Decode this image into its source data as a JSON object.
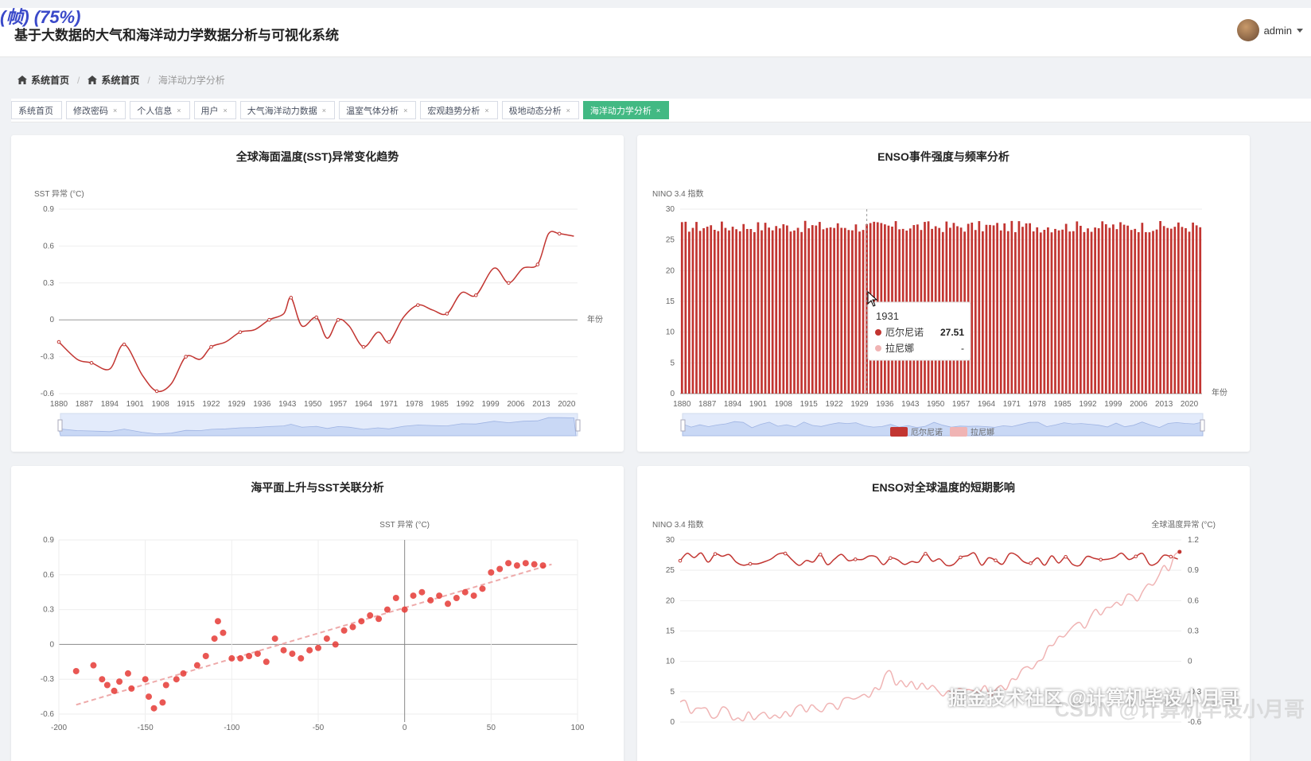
{
  "overlay_label": "(帧) (75%)",
  "header": {
    "title": "基于大数据的大气和海洋动力学数据分析与可视化系统",
    "username": "admin"
  },
  "breadcrumb": [
    "系统首页",
    "系统首页",
    "海洋动力学分析"
  ],
  "tags": [
    {
      "label": "系统首页",
      "closable": false,
      "active": false
    },
    {
      "label": "修改密码",
      "closable": true,
      "active": false
    },
    {
      "label": "个人信息",
      "closable": true,
      "active": false
    },
    {
      "label": "用户",
      "closable": true,
      "active": false
    },
    {
      "label": "大气海洋动力数据",
      "closable": true,
      "active": false
    },
    {
      "label": "温室气体分析",
      "closable": true,
      "active": false
    },
    {
      "label": "宏观趋势分析",
      "closable": true,
      "active": false
    },
    {
      "label": "极地动态分析",
      "closable": true,
      "active": false
    },
    {
      "label": "海洋动力学分析",
      "closable": true,
      "active": true
    }
  ],
  "close_glyph": "×",
  "colors": {
    "accent": "#42b983",
    "el_nino": "#c23531",
    "la_nina": "#f0b4b4",
    "scatter": "#e53935"
  },
  "watermark": {
    "text1": "掘金技术社区 @计算机毕设小月哥",
    "text2": "CSDN @计算机毕设小月哥"
  },
  "chart_data": [
    {
      "type": "line",
      "title": "全球海面温度(SST)异常变化趋势",
      "ylabel": "SST 异常 (°C)",
      "xlabel": "年份",
      "ylim": [
        -0.6,
        0.9
      ],
      "yticks": [
        "-0.6",
        "-0.3",
        "0",
        "0.3",
        "0.6",
        "0.9"
      ],
      "xticks": [
        "1880",
        "1887",
        "1894",
        "1901",
        "1908",
        "1915",
        "1922",
        "1929",
        "1936",
        "1943",
        "1950",
        "1957",
        "1964",
        "1971",
        "1978",
        "1985",
        "1992",
        "1999",
        "2006",
        "2013",
        "2020"
      ],
      "x": [
        1880,
        1885,
        1889,
        1894,
        1898,
        1903,
        1907,
        1911,
        1915,
        1919,
        1922,
        1926,
        1930,
        1934,
        1938,
        1942,
        1944,
        1947,
        1951,
        1954,
        1957,
        1960,
        1964,
        1968,
        1971,
        1975,
        1979,
        1983,
        1987,
        1991,
        1995,
        2000,
        2004,
        2008,
        2012,
        2015,
        2018,
        2022
      ],
      "y": [
        -0.18,
        -0.32,
        -0.35,
        -0.4,
        -0.2,
        -0.45,
        -0.58,
        -0.52,
        -0.3,
        -0.32,
        -0.22,
        -0.18,
        -0.1,
        -0.08,
        0.0,
        0.05,
        0.18,
        -0.05,
        0.02,
        -0.15,
        0.0,
        -0.05,
        -0.22,
        -0.1,
        -0.18,
        0.02,
        0.12,
        0.08,
        0.05,
        0.22,
        0.2,
        0.42,
        0.3,
        0.42,
        0.45,
        0.7,
        0.7,
        0.68
      ],
      "grid": true,
      "data_zoom": true
    },
    {
      "type": "bar",
      "title": "ENSO事件强度与频率分析",
      "ylabel": "NINO 3.4 指数",
      "xlabel": "年份",
      "ylim": [
        0,
        30
      ],
      "yticks": [
        "0",
        "5",
        "10",
        "15",
        "20",
        "25",
        "30"
      ],
      "xticks": [
        "1880",
        "1887",
        "1894",
        "1901",
        "1908",
        "1915",
        "1922",
        "1929",
        "1936",
        "1943",
        "1950",
        "1957",
        "1964",
        "1971",
        "1978",
        "1985",
        "1992",
        "1999",
        "2006",
        "2013",
        "2020"
      ],
      "year_range": [
        1880,
        2023
      ],
      "series": [
        {
          "name": "厄尔尼诺"
        },
        {
          "name": "拉尼娜"
        }
      ],
      "typical_range": [
        26.2,
        28.1
      ],
      "tooltip": {
        "year": "1931",
        "rows": [
          {
            "label": "厄尔尼诺",
            "value": "27.51"
          },
          {
            "label": "拉尼娜",
            "value": "-"
          }
        ]
      },
      "legend": "bottom-center",
      "data_zoom": true
    },
    {
      "type": "scatter",
      "title": "海平面上升与SST关联分析",
      "ylabel": "SST 异常 (°C)",
      "xlim": [
        -200,
        100
      ],
      "ylim": [
        -0.6,
        0.9
      ],
      "xticks": [
        "-200",
        "-150",
        "-100",
        "-50",
        "0",
        "50",
        "100"
      ],
      "yticks": [
        "-0.6",
        "-0.3",
        "0",
        "0.3",
        "0.6",
        "0.9"
      ],
      "points": [
        [
          -190,
          -0.23
        ],
        [
          -180,
          -0.18
        ],
        [
          -175,
          -0.3
        ],
        [
          -172,
          -0.35
        ],
        [
          -168,
          -0.4
        ],
        [
          -165,
          -0.32
        ],
        [
          -160,
          -0.25
        ],
        [
          -158,
          -0.38
        ],
        [
          -150,
          -0.3
        ],
        [
          -148,
          -0.45
        ],
        [
          -145,
          -0.55
        ],
        [
          -140,
          -0.5
        ],
        [
          -138,
          -0.35
        ],
        [
          -132,
          -0.3
        ],
        [
          -128,
          -0.25
        ],
        [
          -120,
          -0.18
        ],
        [
          -115,
          -0.1
        ],
        [
          -110,
          0.05
        ],
        [
          -108,
          0.2
        ],
        [
          -105,
          0.1
        ],
        [
          -100,
          -0.12
        ],
        [
          -95,
          -0.12
        ],
        [
          -90,
          -0.1
        ],
        [
          -85,
          -0.08
        ],
        [
          -80,
          -0.15
        ],
        [
          -75,
          0.05
        ],
        [
          -70,
          -0.05
        ],
        [
          -65,
          -0.08
        ],
        [
          -60,
          -0.12
        ],
        [
          -55,
          -0.05
        ],
        [
          -50,
          -0.03
        ],
        [
          -45,
          0.05
        ],
        [
          -40,
          0.0
        ],
        [
          -35,
          0.12
        ],
        [
          -30,
          0.15
        ],
        [
          -25,
          0.2
        ],
        [
          -20,
          0.25
        ],
        [
          -15,
          0.22
        ],
        [
          -10,
          0.3
        ],
        [
          -5,
          0.4
        ],
        [
          0,
          0.3
        ],
        [
          5,
          0.42
        ],
        [
          10,
          0.45
        ],
        [
          15,
          0.38
        ],
        [
          20,
          0.42
        ],
        [
          25,
          0.35
        ],
        [
          30,
          0.4
        ],
        [
          35,
          0.45
        ],
        [
          40,
          0.42
        ],
        [
          45,
          0.48
        ],
        [
          50,
          0.62
        ],
        [
          55,
          0.65
        ],
        [
          60,
          0.7
        ],
        [
          65,
          0.68
        ],
        [
          70,
          0.7
        ],
        [
          75,
          0.69
        ],
        [
          80,
          0.68
        ]
      ],
      "trendline": [
        [
          -190,
          -0.52
        ],
        [
          85,
          0.69
        ]
      ],
      "grid": true
    },
    {
      "type": "line",
      "title": "ENSO对全球温度的短期影响",
      "ylabel": "NINO 3.4 指数",
      "ylabel_right": "全球温度异常 (°C)",
      "ylim": [
        0,
        30
      ],
      "ylim_right": [
        -0.6,
        1.2
      ],
      "yticks": [
        "0",
        "5",
        "10",
        "15",
        "20",
        "25",
        "30"
      ],
      "yticks_right": [
        "-0.6",
        "-0.3",
        "0",
        "0.3",
        "0.6",
        "0.9",
        "1.2"
      ],
      "year_range": [
        1880,
        2023
      ],
      "series": [
        {
          "name": "NINO 3.4",
          "typical_range": [
            25.8,
            27.9
          ]
        },
        {
          "name": "全球温度异常",
          "x": [
            1880,
            1890,
            1900,
            1910,
            1920,
            1930,
            1940,
            1950,
            1960,
            1970,
            1980,
            1990,
            2000,
            2010,
            2020,
            2023
          ],
          "values": [
            -0.45,
            -0.5,
            -0.55,
            -0.52,
            -0.45,
            -0.38,
            -0.15,
            -0.3,
            -0.28,
            -0.3,
            -0.05,
            0.25,
            0.48,
            0.65,
            0.95,
            1.18
          ]
        }
      ]
    }
  ]
}
